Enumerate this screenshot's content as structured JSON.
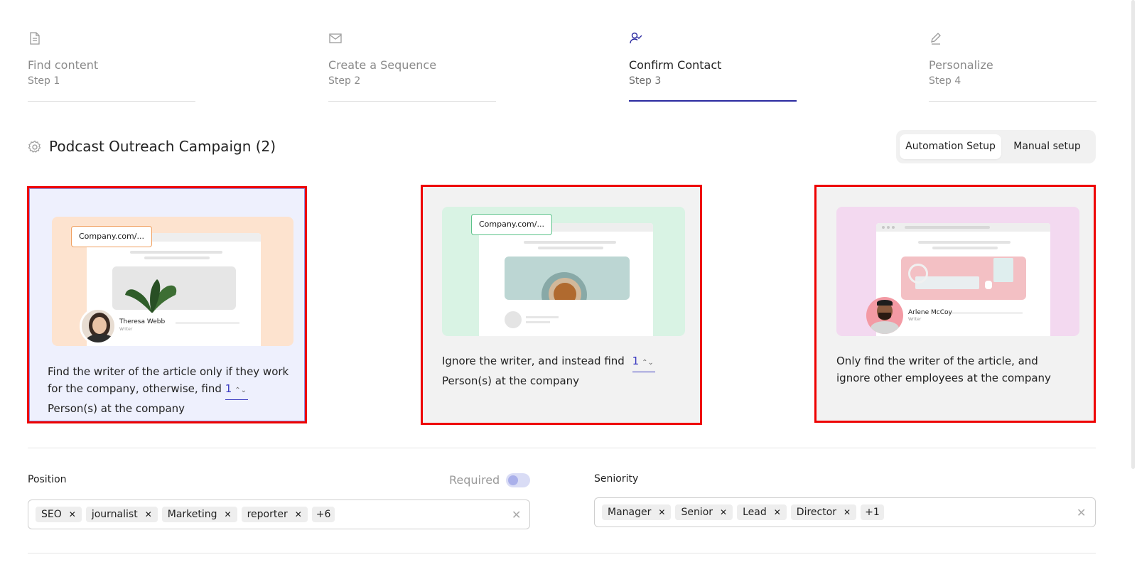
{
  "steps": [
    {
      "title": "Find content",
      "sub": "Step 1",
      "icon": "document-icon"
    },
    {
      "title": "Create a Sequence",
      "sub": "Step 2",
      "icon": "envelope-icon"
    },
    {
      "title": "Confirm Contact",
      "sub": "Step 3",
      "icon": "user-check-icon"
    },
    {
      "title": "Personalize",
      "sub": "Step 4",
      "icon": "pencil-icon"
    }
  ],
  "active_step": 3,
  "header": {
    "title": "Podcast Outreach Campaign (2)",
    "automation_label": "Automation Setup",
    "manual_label": "Manual setup"
  },
  "cards": [
    {
      "url": "Company.com/...",
      "writer_name": "Theresa Webb",
      "writer_role": "Writer",
      "text_before": "Find the writer of the article only if they work for the company, otherwise, find",
      "count": "1",
      "text_after": "Person(s) at the company"
    },
    {
      "url": "Company.com/...",
      "text_before": "Ignore the writer, and instead find",
      "count": "1",
      "text_after": "Person(s) at the company"
    },
    {
      "writer_name": "Arlene McCoy",
      "writer_role": "Writer",
      "text": "Only find the writer of the article, and ignore other employees at the company"
    }
  ],
  "position": {
    "label": "Position",
    "required_label": "Required",
    "tags": [
      "SEO",
      "journalist",
      "Marketing",
      "reporter"
    ],
    "more": "+6"
  },
  "seniority": {
    "label": "Seniority",
    "tags": [
      "Manager",
      "Senior",
      "Lead",
      "Director"
    ],
    "more": "+1"
  },
  "colors": {
    "accent": "#2b2aa0",
    "highlight_border": "#ee0000",
    "card1_bg": "#eef0fd",
    "illus1_bg": "#fde3cf",
    "illus2_bg": "#d9f3e4",
    "illus3_bg": "#f3d9f0"
  }
}
